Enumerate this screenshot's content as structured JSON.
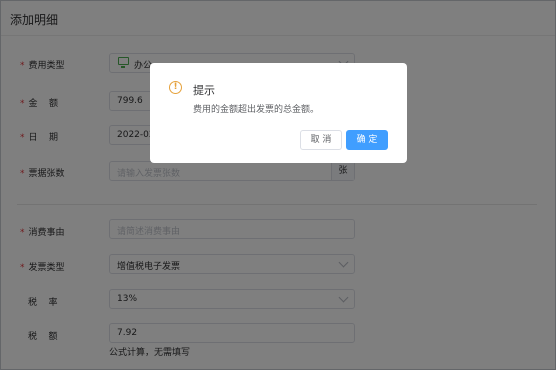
{
  "window": {
    "title": "添加明细"
  },
  "form": {
    "fee_type": {
      "label": "费用类型",
      "value": "办公"
    },
    "amount": {
      "label": "金    额",
      "value": "799.6"
    },
    "date": {
      "label": "日    期",
      "value": "2022-02"
    },
    "invoice_count": {
      "label": "票据张数",
      "placeholder": "请输入发票张数",
      "suffix": "张"
    },
    "reason": {
      "label": "消费事由",
      "placeholder": "请简述消费事由"
    },
    "invoice_type": {
      "label": "发票类型",
      "value": "增值税电子发票"
    },
    "tax_rate": {
      "label": "税    率",
      "value": "13%"
    },
    "tax_amount": {
      "label": "税    额",
      "value": "7.92",
      "hint": "公式计算，无需填写"
    }
  },
  "required_mark": "*",
  "dialog": {
    "icon": "warning-icon",
    "title": "提示",
    "message": "费用的金额超出发票的总金额。",
    "cancel_label": "取 消",
    "confirm_label": "确 定"
  },
  "colors": {
    "primary": "#409eff",
    "warning": "#e6a23c",
    "required": "#e0393e"
  }
}
